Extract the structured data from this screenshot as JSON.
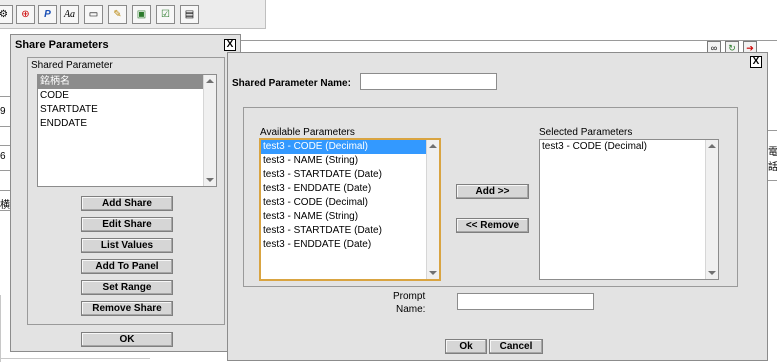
{
  "toolbar": {
    "icons": [
      "gear-icon",
      "pdf-export-icon",
      "parameter-icon",
      "font-icon",
      "window-icon",
      "edit-icon",
      "image-icon",
      "checkbox-icon",
      "report-icon"
    ]
  },
  "background": {
    "side_numbers": [
      "9",
      "6"
    ],
    "side_text": "横",
    "right_text": "電話"
  },
  "share_dialog": {
    "title": "Share Parameters",
    "close": "X",
    "legend": "Shared Parameter",
    "items": [
      "銘柄名",
      "CODE",
      "STARTDATE",
      "ENDDATE"
    ],
    "selected_index": 0,
    "buttons": {
      "add_share": "Add Share",
      "edit_share": "Edit Share",
      "list_values": "List Values",
      "add_to_panel": "Add To Panel",
      "set_range": "Set Range",
      "remove_share": "Remove Share"
    },
    "ok": "OK"
  },
  "param_dialog": {
    "close": "X",
    "name_label": "Shared Parameter Name:",
    "name_value": "",
    "available_label": "Available Parameters",
    "available": [
      "test3 - CODE (Decimal)",
      "test3 - NAME (String)",
      "test3 - STARTDATE (Date)",
      "test3 - ENDDATE (Date)",
      "test3 - CODE (Decimal)",
      "test3 - NAME (String)",
      "test3 - STARTDATE (Date)",
      "test3 - ENDDATE (Date)"
    ],
    "available_selected_index": 0,
    "selected_label": "Selected Parameters",
    "selected": [
      "test3 - CODE (Decimal)"
    ],
    "add_button": "Add >>",
    "remove_button": "<< Remove",
    "prompt_label_1": "Prompt",
    "prompt_label_2": "Name:",
    "prompt_value": "",
    "ok": "Ok",
    "cancel": "Cancel"
  }
}
